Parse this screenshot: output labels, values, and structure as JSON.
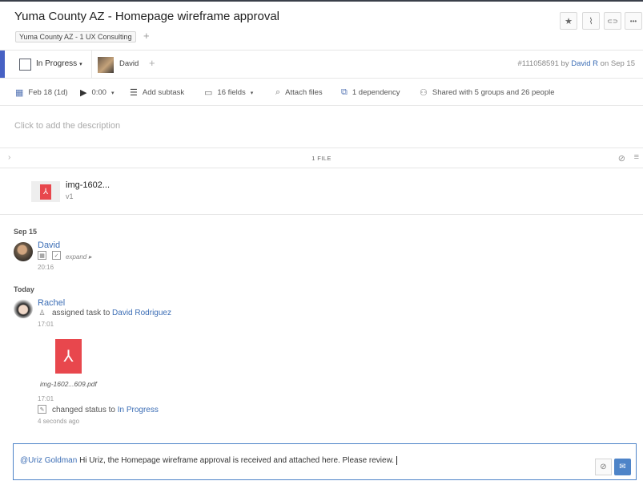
{
  "task": {
    "title": "Yuma County AZ - Homepage wireframe approval",
    "folder": "Yuma County AZ - 1 UX Consulting",
    "folder_add": "+"
  },
  "header_buttons": [
    {
      "icon": "star-icon",
      "glyph": "★"
    },
    {
      "icon": "rss-icon",
      "glyph": "⌇"
    },
    {
      "icon": "link-icon",
      "glyph": "⊂⊃"
    },
    {
      "icon": "more-icon",
      "glyph": "•••"
    }
  ],
  "status": {
    "label": "In Progress",
    "caret": "▾",
    "accent_color": "#4761c4"
  },
  "assignee": {
    "name": "David",
    "add": "+"
  },
  "meta": {
    "task_id": "#111058591",
    "by": "by",
    "author": "David R",
    "on": "on Sep 15"
  },
  "toolbar": {
    "date": "Feb 18 (1d)",
    "timer": "0:00",
    "timer_caret": "▾",
    "add_subtask": "Add subtask",
    "fields": "16 fields",
    "fields_caret": "▾",
    "attach_files": "Attach files",
    "dependency": "1 dependency",
    "shared": "Shared with 5 groups and 26 people"
  },
  "description_placeholder": "Click to add the description",
  "files": {
    "count_label": "1 FILE",
    "items": [
      {
        "name": "img-1602...",
        "version": "v1"
      }
    ]
  },
  "stream": {
    "day1": "Sep 15",
    "entry1": {
      "user": "David",
      "expand": "expand",
      "time": "20:16"
    },
    "day2": "Today",
    "entry2": {
      "user": "Rachel",
      "action": "assigned task to",
      "target": "David Rodriguez",
      "time": "17:01",
      "file_name": "img-1602...609.pdf",
      "file_time": "17:01",
      "status_action": "changed status to",
      "status_target": "In Progress",
      "status_time": "4 seconds ago"
    }
  },
  "comment": {
    "mention": "@Uriz Goldman",
    "text": "Hi Uriz, the Homepage wireframe approval is received and attached here. Please review."
  },
  "colors": {
    "link": "#3b6db5",
    "pdf": "#e8474d",
    "comment_border": "#4e84c8"
  }
}
